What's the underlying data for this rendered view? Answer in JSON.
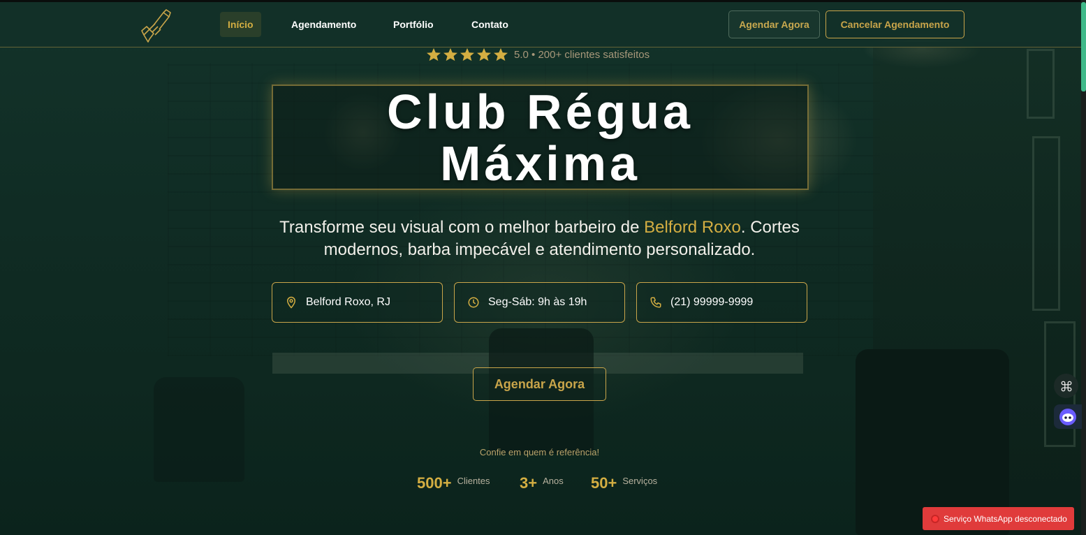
{
  "header": {
    "nav": [
      {
        "label": "Início",
        "active": true
      },
      {
        "label": "Agendamento",
        "active": false
      },
      {
        "label": "Portfólio",
        "active": false
      },
      {
        "label": "Contato",
        "active": false
      }
    ],
    "book_button": "Agendar Agora",
    "cancel_button": "Cancelar Agendamento"
  },
  "hero": {
    "stars": 5,
    "rating_text": "5.0 • 200+ clientes satisfeitos",
    "title_line1": "Club Régua",
    "title_line2": "Máxima",
    "subtitle_before": "Transforme seu visual com o melhor barbeiro de ",
    "subtitle_highlight": "Belford Roxo",
    "subtitle_after": ". Cortes modernos, barba impecável e atendimento personalizado.",
    "info": {
      "location": "Belford Roxo, RJ",
      "hours": "Seg-Sáb: 9h às 19h",
      "phone": "(21) 99999-9999"
    },
    "cta": "Agendar Agora",
    "trust_text": "Confie em quem é referência!",
    "stats": [
      {
        "value": "500+",
        "label": "Clientes"
      },
      {
        "value": "3+",
        "label": "Anos"
      },
      {
        "value": "50+",
        "label": "Serviços"
      }
    ]
  },
  "widgets": {
    "whatsapp_status": "Serviço WhatsApp desconectado"
  },
  "colors": {
    "accent": "#c9a54a",
    "background": "#12302a",
    "toast": "#e03b3b"
  },
  "icons": {
    "logo": "razor-hand-logo",
    "location": "map-pin-icon",
    "hours": "clock-icon",
    "phone": "phone-icon"
  }
}
